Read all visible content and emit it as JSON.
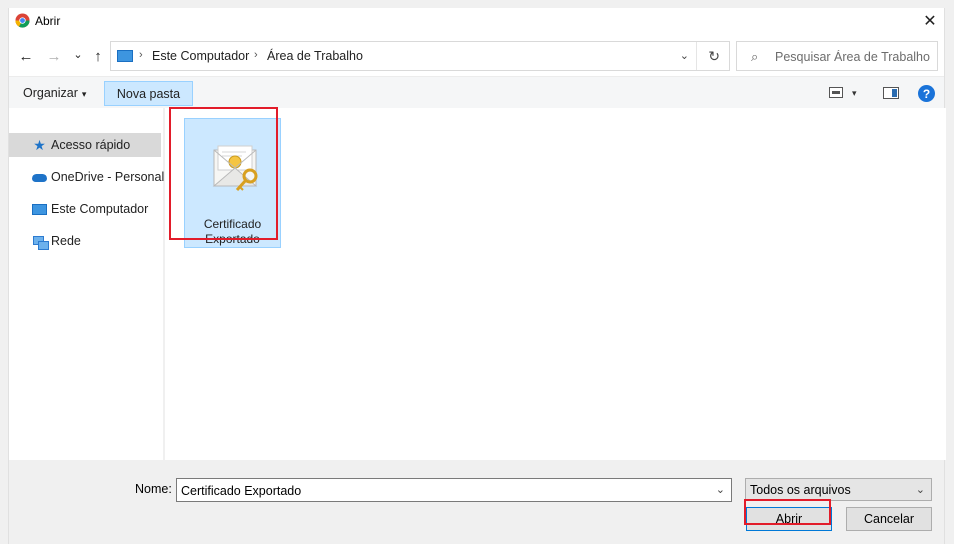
{
  "window": {
    "title": "Abrir",
    "close_glyph": "✕"
  },
  "nav": {
    "back_glyph": "←",
    "forward_glyph": "→",
    "recent_glyph": "⌄",
    "up_glyph": "↑",
    "breadcrumbs": [
      "Este Computador",
      "Área de Trabalho"
    ],
    "separator_glyph": "›",
    "dropdown_glyph": "⌄",
    "refresh_glyph": "↻",
    "search_placeholder": "Pesquisar Área de Trabalho",
    "search_glyph": "⌕"
  },
  "toolbar": {
    "organize_label": "Organizar",
    "caret_glyph": "▾",
    "new_folder_label": "Nova pasta",
    "help_glyph": "?"
  },
  "sidebar": {
    "items": [
      {
        "label": "Acesso rápido",
        "icon": "star-icon",
        "selected": true
      },
      {
        "label": "OneDrive - Personal",
        "icon": "cloud-icon",
        "selected": false
      },
      {
        "label": "Este Computador",
        "icon": "computer-icon",
        "selected": false
      },
      {
        "label": "Rede",
        "icon": "network-icon",
        "selected": false
      }
    ]
  },
  "files": [
    {
      "name_line1": "Certificado",
      "name_line2": "Exportado",
      "icon": "certificate-icon",
      "selected": true
    }
  ],
  "footer": {
    "name_label": "Nome:",
    "name_value": "Certificado Exportado",
    "dropdown_glyph": "⌄",
    "filter_value": "Todos os arquivos",
    "open_label": "Abrir",
    "cancel_label": "Cancelar"
  },
  "colors": {
    "selection_bg": "#cce8ff",
    "selection_border": "#99d1ff",
    "annotation_red": "#e21c2a",
    "accent_blue": "#0078d7"
  }
}
